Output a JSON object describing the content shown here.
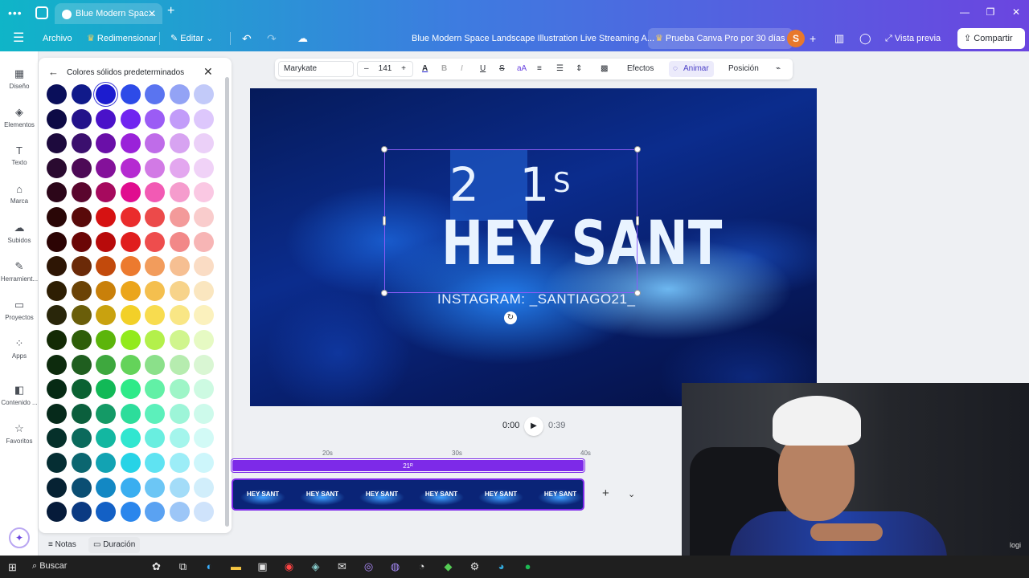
{
  "browser": {
    "tab_title": "Blue Modern Spac...",
    "new_tab": "+",
    "window_controls": [
      "—",
      "❐",
      "✕"
    ]
  },
  "topbar": {
    "archivo": "Archivo",
    "redimensionar": "Redimensionar",
    "editar": "Editar",
    "doc_title": "Blue Modern Space Landscape Illustration Live Streaming A...",
    "pro_promo": "Prueba Canva Pro por 30 días",
    "avatar_initial": "S",
    "preview": "Vista previa",
    "share": "Compartir"
  },
  "rail": {
    "items": [
      {
        "label": "Diseño",
        "icon": "layout-icon"
      },
      {
        "label": "Elementos",
        "icon": "elements-icon"
      },
      {
        "label": "Texto",
        "icon": "text-icon"
      },
      {
        "label": "Marca",
        "icon": "brand-icon"
      },
      {
        "label": "Subidos",
        "icon": "upload-icon"
      },
      {
        "label": "Herramient...",
        "icon": "tools-icon"
      },
      {
        "label": "Proyectos",
        "icon": "folder-icon"
      },
      {
        "label": "Apps",
        "icon": "apps-icon"
      },
      {
        "label": "Contenido ...",
        "icon": "content-icon"
      },
      {
        "label": "Favoritos",
        "icon": "star-icon"
      }
    ]
  },
  "color_panel": {
    "title": "Colores sólidos predeterminados",
    "selected": "#1c1ccf",
    "rows": [
      [
        "#0a0f5a",
        "#101a8a",
        "#1c1ccf",
        "#2d4be8",
        "#5a74f0",
        "#93a3f5",
        "#c2caf9"
      ],
      [
        "#0d0a45",
        "#23128a",
        "#4a12c9",
        "#7024f0",
        "#9b5cf5",
        "#c29cf9",
        "#ddc7fc"
      ],
      [
        "#1d0a3d",
        "#3b0f6e",
        "#6a0fa8",
        "#9a22d9",
        "#bf6ce9",
        "#d7a3f1",
        "#ebd0f8"
      ],
      [
        "#2a0a30",
        "#4d0a56",
        "#84119a",
        "#b52ad1",
        "#d27ae5",
        "#e3a7ef",
        "#f0d2f7"
      ],
      [
        "#2c0619",
        "#5a062e",
        "#a60a5e",
        "#e00d8f",
        "#f25ab4",
        "#f59ccd",
        "#fac8e3"
      ],
      [
        "#2a0707",
        "#590a0a",
        "#d61212",
        "#ea2c2c",
        "#ec4a4a",
        "#f39a9a",
        "#f9cccc"
      ],
      [
        "#2c0404",
        "#6b0606",
        "#b80b0b",
        "#e01e1e",
        "#ee4d4d",
        "#f28888",
        "#f7b5b5"
      ],
      [
        "#2e1605",
        "#6b2a08",
        "#c24a0c",
        "#ec7a2f",
        "#f29c5c",
        "#f6bf92",
        "#fadcc4"
      ],
      [
        "#2e1e03",
        "#6b4306",
        "#c9800a",
        "#eba51b",
        "#f4bf4e",
        "#f7d38a",
        "#fae6bf"
      ],
      [
        "#29260a",
        "#6a5e0a",
        "#c9a20f",
        "#f2d028",
        "#f8dc4f",
        "#f9e685",
        "#fbf1bd"
      ],
      [
        "#132a05",
        "#2e5e08",
        "#5cb50b",
        "#92ea1c",
        "#b3f04b",
        "#d0f58d",
        "#e6fac3"
      ],
      [
        "#0d2b0d",
        "#1f5e1f",
        "#3ea83e",
        "#64d35a",
        "#8be08a",
        "#b6ecaf",
        "#d9f6d3"
      ],
      [
        "#062a14",
        "#0b6232",
        "#12b957",
        "#2eea88",
        "#62f0a6",
        "#9ef5c7",
        "#cdfae2"
      ],
      [
        "#062a1b",
        "#0b5f3d",
        "#149a66",
        "#2ddd9b",
        "#5cf0bb",
        "#9df5d8",
        "#cdfaeb"
      ],
      [
        "#05302a",
        "#0b6a5c",
        "#13b7a1",
        "#31e6d0",
        "#69eee0",
        "#a4f5ec",
        "#d2faf6"
      ],
      [
        "#052e33",
        "#0b6670",
        "#12a3b3",
        "#27d3e6",
        "#5fe3f2",
        "#9cedf7",
        "#cdf6fb"
      ],
      [
        "#062233",
        "#0b4e73",
        "#1388c4",
        "#3aaef0",
        "#6cc6f5",
        "#a3dcf8",
        "#d1eefb"
      ],
      [
        "#061b3a",
        "#0b3a82",
        "#1360c5",
        "#2a86ec",
        "#5aa2f2",
        "#9cc6f7",
        "#cfe3fb"
      ]
    ]
  },
  "footer": {
    "notes": "Notas",
    "duration": "Duración"
  },
  "toolbar": {
    "font": "Marykate",
    "size": "141",
    "minus": "–",
    "plus": "+",
    "effects": "Efectos",
    "animate": "Animar",
    "position": "Posición"
  },
  "canvas": {
    "line1": "2 1",
    "line1_s": "S",
    "line2": "HEY SANT",
    "instagram": "INSTAGRAM: _SANTIAGO21_"
  },
  "playback": {
    "current": "0:00",
    "total": "0:39"
  },
  "timeline": {
    "ticks": [
      "20s",
      "30s",
      "40s"
    ],
    "audio_label": "21ᴿ",
    "thumb_label": "HEY SANT"
  },
  "webcam": {
    "logo": "logi"
  },
  "taskbar": {
    "search": "Buscar"
  }
}
